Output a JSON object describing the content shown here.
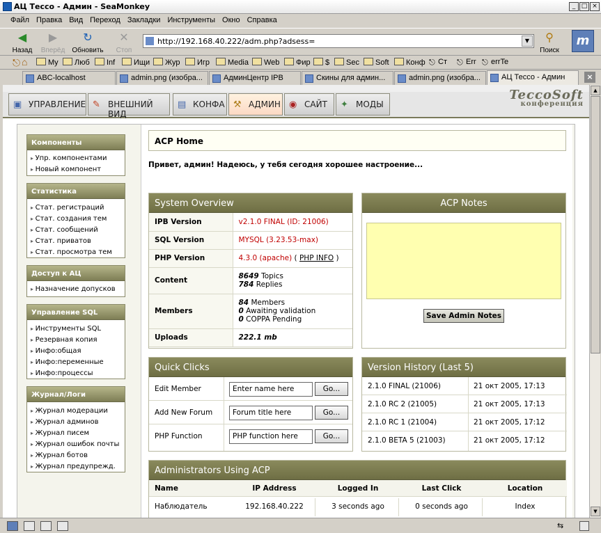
{
  "window": {
    "title": "АЦ Тессо - Админ - SeaMonkey"
  },
  "menu": [
    "Файл",
    "Правка",
    "Вид",
    "Переход",
    "Закладки",
    "Инструменты",
    "Окно",
    "Справка"
  ],
  "nav": {
    "back": "Назад",
    "forward": "Вперёд",
    "reload": "Обновить",
    "stop": "Стоп",
    "search": "Поиск",
    "url": "http://192.168.40.222/adm.php?adsess="
  },
  "bookmarks": [
    "My",
    "Люб",
    "Inf",
    "Ищи",
    "Жур",
    "Игр",
    "Media",
    "Web",
    "Фир",
    "$",
    "Sec",
    "Soft",
    "Конф",
    "Ст",
    "Err",
    "errTe"
  ],
  "tabs": [
    "ABC-localhost",
    "admin.png (изобра...",
    "АдминЦентр IPB",
    "Скины для админ...",
    "admin.png (изобра...",
    "АЦ Тессо - Админ"
  ],
  "acp_tabs": [
    "Управление",
    "Внешний вид",
    "Конфа",
    "Админ",
    "Сайт",
    "Моды"
  ],
  "logo": {
    "line1": "TeccoSoft",
    "line2": "конференция"
  },
  "sidebar": [
    {
      "title": "Компоненты",
      "items": [
        "Упр. компонентами",
        "Новый компонент"
      ]
    },
    {
      "title": "Статистика",
      "items": [
        "Стат. регистраций",
        "Стат. создания тем",
        "Стат. сообщений",
        "Стат. приватов",
        "Стат. просмотра тем"
      ]
    },
    {
      "title": "Доступ к АЦ",
      "items": [
        "Назначение допусков"
      ]
    },
    {
      "title": "Управление SQL",
      "items": [
        "Инструменты SQL",
        "Резервная копия",
        "Инфо:общая",
        "Инфо:переменные",
        "Инфо:процессы"
      ]
    },
    {
      "title": "Журнал/Логи",
      "items": [
        "Журнал модерации",
        "Журнал админов",
        "Журнал писем",
        "Журнал ошибок почты",
        "Журнал ботов",
        "Журнал предупрежд."
      ]
    }
  ],
  "main": {
    "title": "ACP Home",
    "greeting": "Привет, админ! Надеюсь, у тебя сегодня хорошее настроение...",
    "overview": {
      "title": "System Overview",
      "ipb_label": "IPB Version",
      "ipb_value": "v2.1.0 FINAL (ID: 21006)",
      "sql_label": "SQL Version",
      "sql_value": "MYSQL (3.23.53-max)",
      "php_label": "PHP Version",
      "php_value": "4.3.0 (apache)",
      "php_info": "PHP INFO",
      "paren_open": "(",
      "paren_close": ")",
      "content_label": "Content",
      "topics_n": "8649",
      "topics": "Topics",
      "replies_n": "784",
      "replies": "Replies",
      "members_label": "Members",
      "members_n": "84",
      "members": "Members",
      "awaiting_n": "0",
      "awaiting": "Awaiting validation",
      "coppa_n": "0",
      "coppa": "COPPA Pending",
      "uploads_label": "Uploads",
      "uploads_value": "222.1 mb"
    },
    "notes": {
      "title": "ACP Notes",
      "button": "Save Admin Notes"
    },
    "quick": {
      "title": "Quick Clicks",
      "rows": [
        {
          "label": "Edit Member",
          "placeholder": "Enter name here",
          "go": "Go..."
        },
        {
          "label": "Add New Forum",
          "placeholder": "Forum title here",
          "go": "Go..."
        },
        {
          "label": "PHP Function",
          "placeholder": "PHP function here",
          "go": "Go..."
        }
      ]
    },
    "history": {
      "title": "Version History (Last 5)",
      "rows": [
        {
          "version": "2.1.0 FINAL (21006)",
          "date": "21 окт 2005, 17:13"
        },
        {
          "version": "2.1.0 RC 2 (21005)",
          "date": "21 окт 2005, 17:13"
        },
        {
          "version": "2.1.0 RC 1 (21004)",
          "date": "21 окт 2005, 17:12"
        },
        {
          "version": "2.1.0 BETA 5 (21003)",
          "date": "21 окт 2005, 17:12"
        }
      ]
    },
    "admins": {
      "title": "Administrators Using ACP",
      "headers": [
        "Name",
        "IP Address",
        "Logged In",
        "Last Click",
        "Location"
      ],
      "row": [
        "Наблюдатель",
        "192.168.40.222",
        "3 seconds ago",
        "0 seconds ago",
        "Index"
      ]
    }
  },
  "colors": {
    "header_bar": "#7a7a50",
    "notes_bg": "#ffffb0",
    "red_value": "#c00000"
  }
}
